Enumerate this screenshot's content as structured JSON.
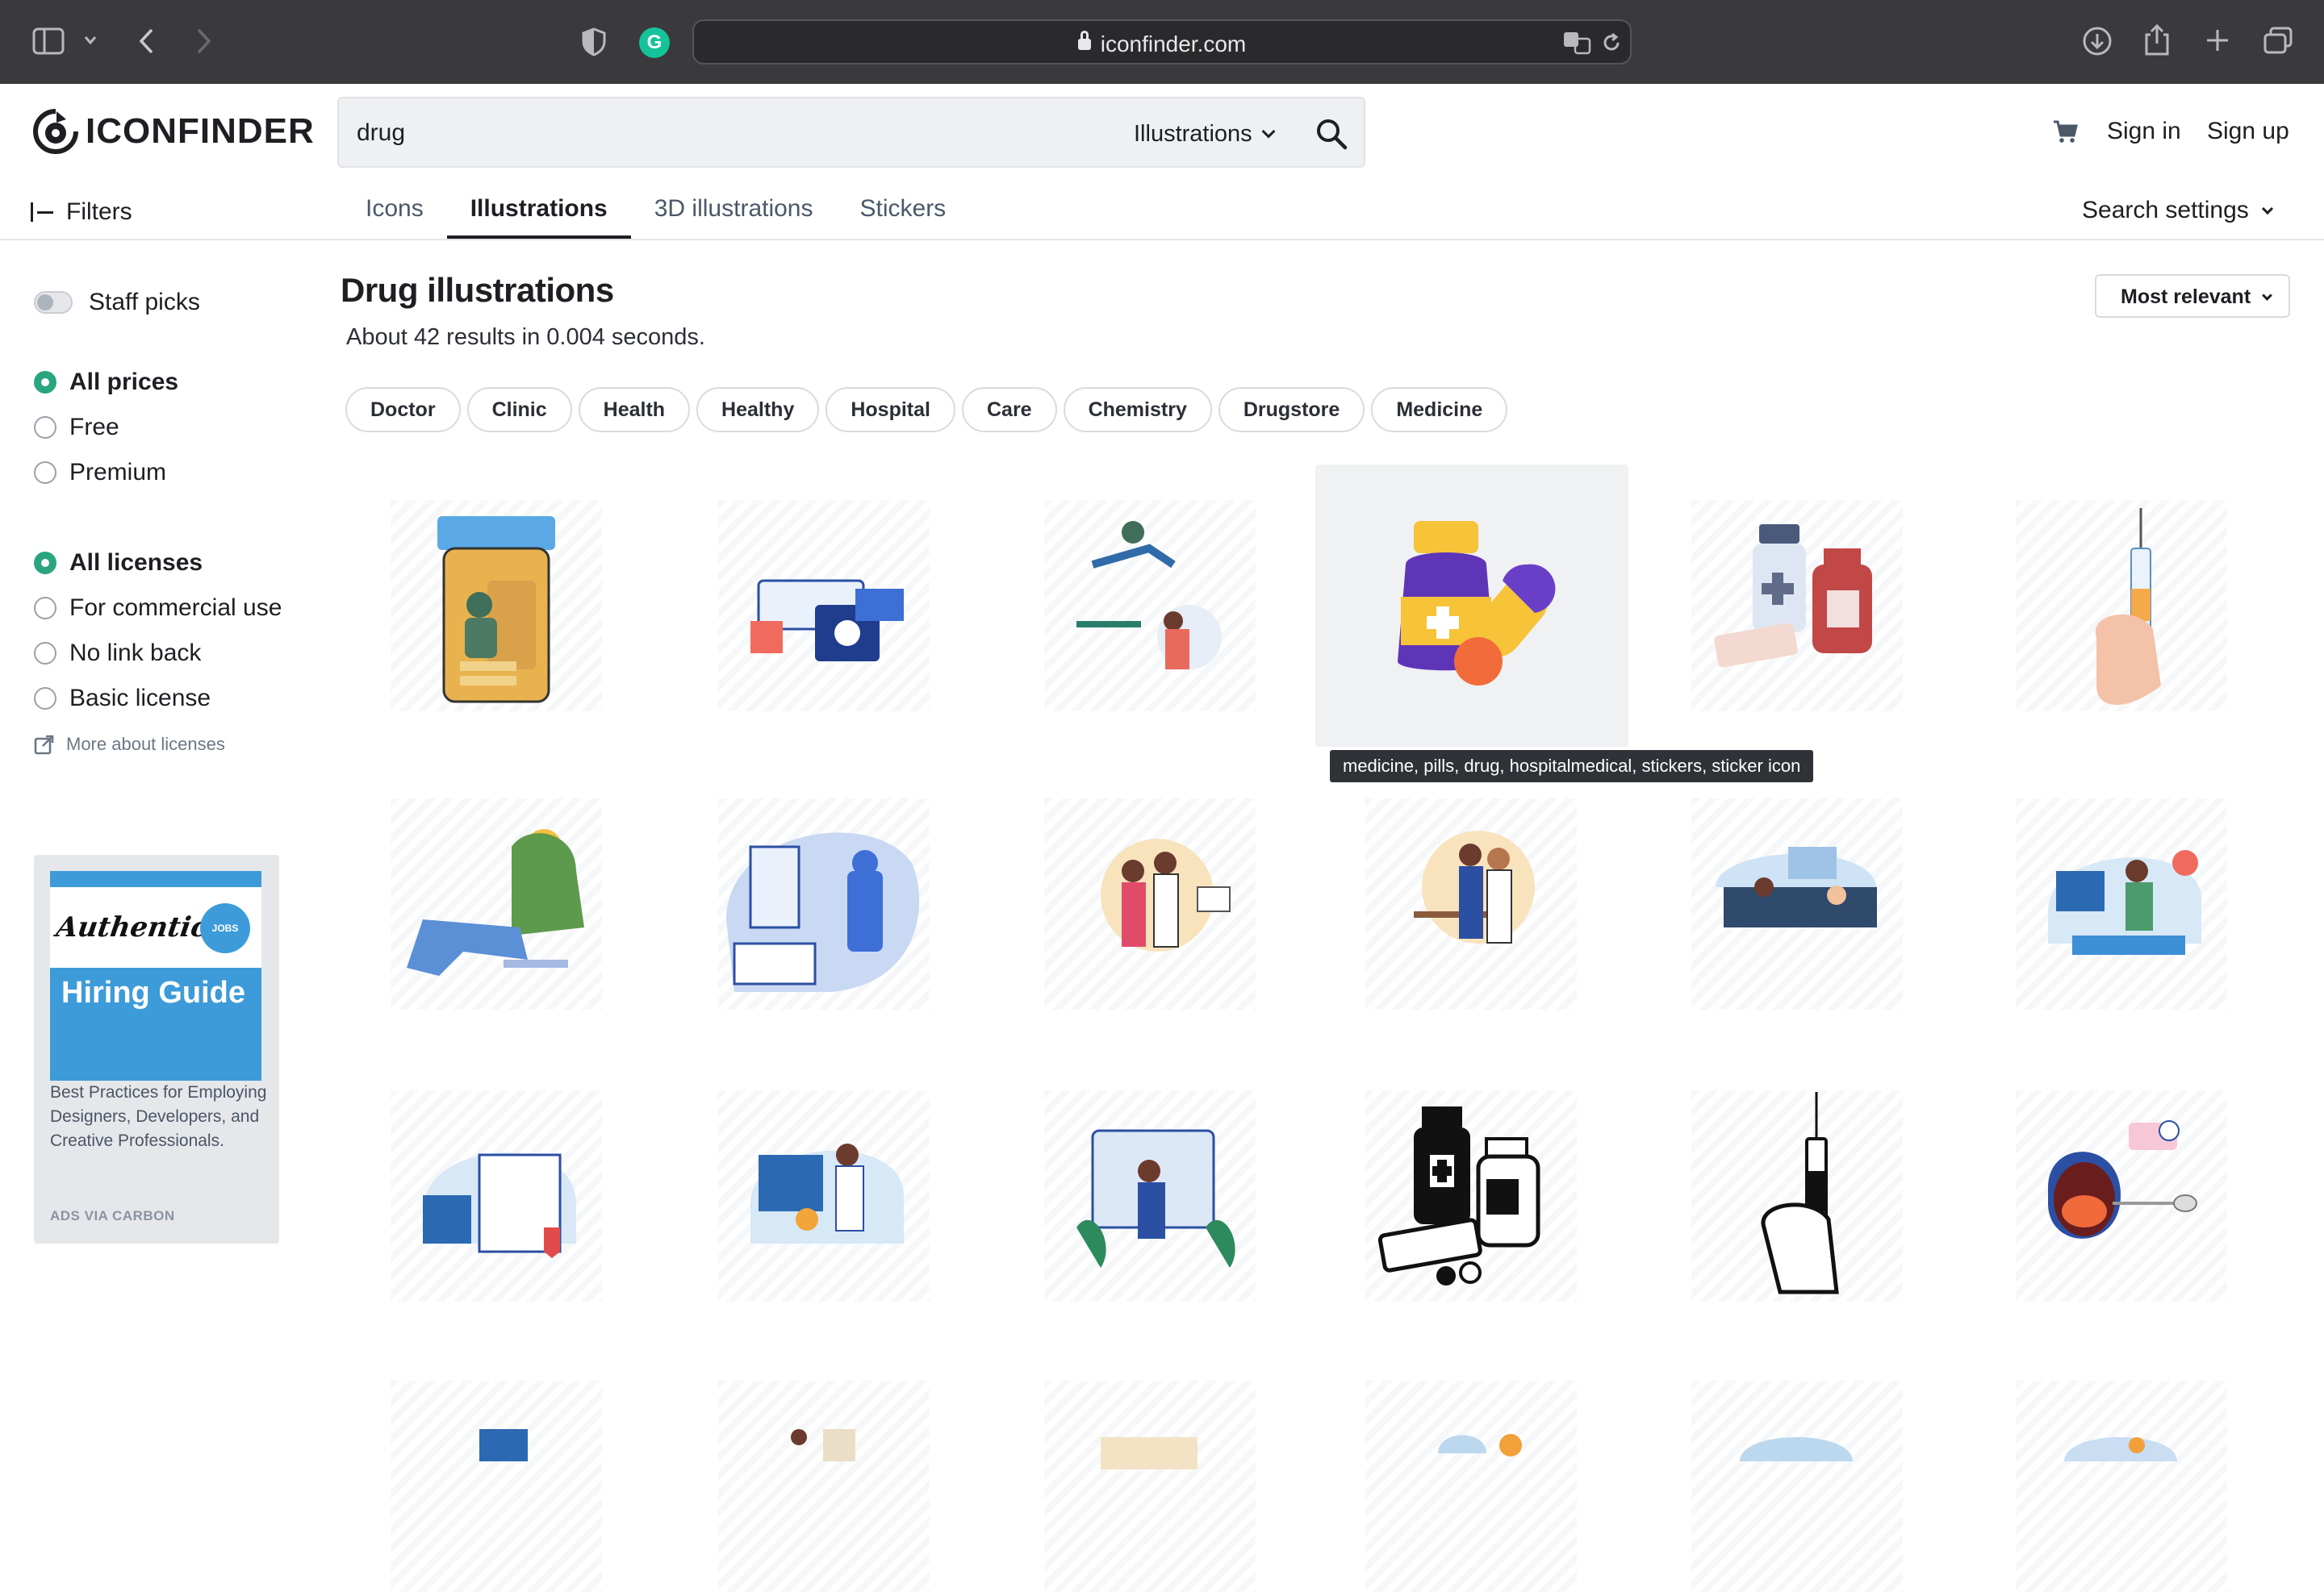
{
  "browser": {
    "url": "iconfinder.com"
  },
  "header": {
    "logo_text": "ICONFINDER",
    "search_query": "drug",
    "search_type": "Illustrations",
    "sign_in": "Sign in",
    "sign_up": "Sign up"
  },
  "subnav": {
    "filters_label": "Filters",
    "tabs": [
      "Icons",
      "Illustrations",
      "3D illustrations",
      "Stickers"
    ],
    "active_tab": "Illustrations",
    "search_settings": "Search settings"
  },
  "sidebar": {
    "staff_picks": "Staff picks",
    "prices": [
      "All prices",
      "Free",
      "Premium"
    ],
    "prices_selected": "All prices",
    "licenses": [
      "All licenses",
      "For commercial use",
      "No link back",
      "Basic license"
    ],
    "licenses_selected": "All licenses",
    "more_licenses": "More about licenses"
  },
  "ad": {
    "brand": "Authentic",
    "badge": "JOBS",
    "headline": "Hiring Guide",
    "body": "Best Practices for Employing Designers, Developers, and Creative Professionals.",
    "footer": "ADS VIA CARBON"
  },
  "main": {
    "title": "Drug illustrations",
    "results": "About 42 results in 0.004 seconds.",
    "sort": "Most relevant",
    "chips": [
      "Doctor",
      "Clinic",
      "Health",
      "Healthy",
      "Hospital",
      "Care",
      "Chemistry",
      "Drugstore",
      "Medicine"
    ],
    "tooltip": "medicine, pills, drug, hospitalmedical, stickers, sticker icon"
  },
  "colors": {
    "accent_green": "#2aa57f",
    "ad_blue": "#3e9bd9",
    "chrome": "#3a3a3c"
  }
}
